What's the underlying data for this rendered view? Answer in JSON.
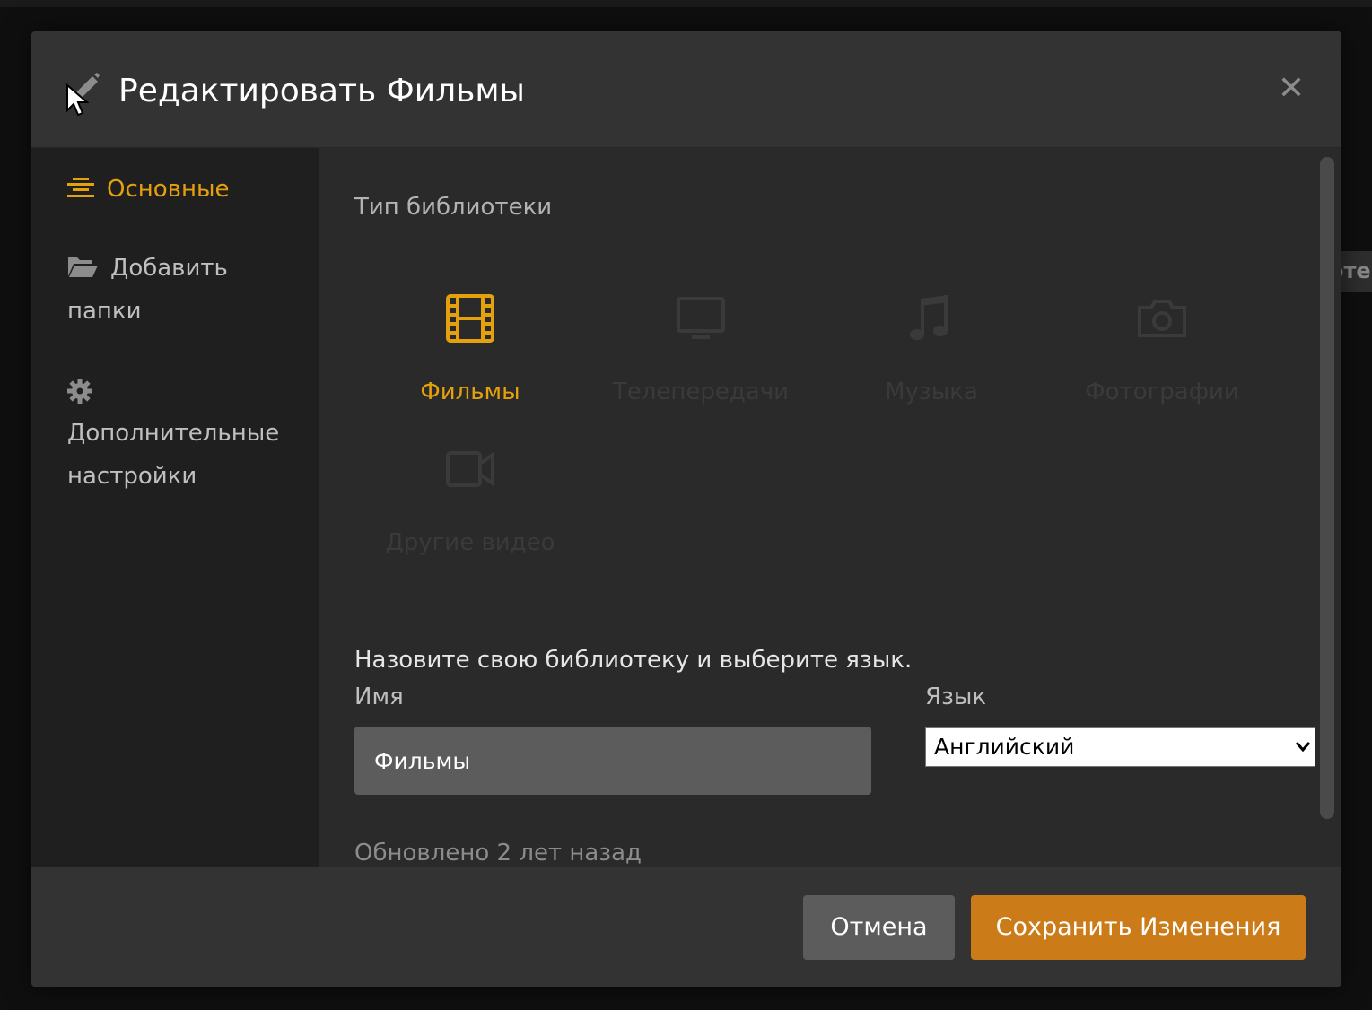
{
  "dialog": {
    "title": "Редактировать Фильмы",
    "close_symbol": "✕",
    "edit_icon": "pencil-icon"
  },
  "sidebar": {
    "items": [
      {
        "label": "Основные",
        "icon": "list-icon",
        "active": true
      },
      {
        "label_line1": "Добавить",
        "label_line2": "папки",
        "icon": "folder-icon",
        "active": false
      },
      {
        "label_line1": "Дополнительные",
        "label_line2": "настройки",
        "icon": "gear-icon",
        "active": false
      }
    ]
  },
  "library_type": {
    "heading": "Тип библиотеки",
    "types": [
      {
        "label": "Фильмы",
        "icon": "film-icon",
        "selected": true
      },
      {
        "label": "Телепередачи",
        "icon": "tv-icon",
        "selected": false
      },
      {
        "label": "Музыка",
        "icon": "music-icon",
        "selected": false
      },
      {
        "label": "Фотографии",
        "icon": "camera-icon",
        "selected": false
      },
      {
        "label": "Другие видео",
        "icon": "video-camera-icon",
        "selected": false
      }
    ]
  },
  "form": {
    "instruction": "Назовите свою библиотеку и выберите язык.",
    "name_label": "Имя",
    "name_value": "Фильмы",
    "language_label": "Язык",
    "language_value": "Английский",
    "updated_text": "Обновлено 2 лет назад"
  },
  "footer": {
    "cancel_label": "Отмена",
    "save_label": "Сохранить Изменения"
  },
  "background": {
    "partial_text": "оте"
  },
  "colors": {
    "accent": "#e5a00d",
    "save_button": "#cc7b19",
    "cancel_button": "#5c5c5c",
    "modal_bg": "#2a2a2a",
    "header_bg": "#333333",
    "sidebar_bg": "#1f1f1f"
  }
}
